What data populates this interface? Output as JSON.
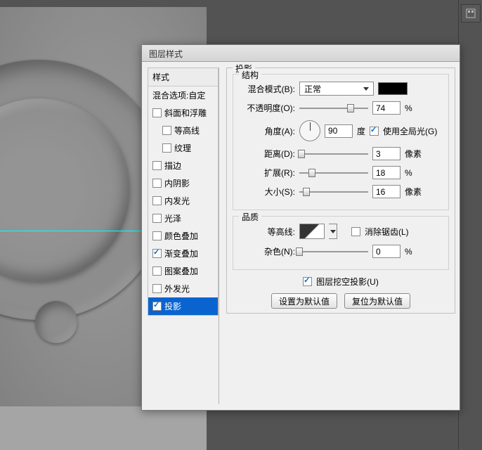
{
  "canvas": {
    "guide_visible": true
  },
  "dialog": {
    "title": "图层样式",
    "styles_panel": {
      "header": "样式",
      "blend_header": "混合选项:自定",
      "items": [
        {
          "label": "斜面和浮雕",
          "checked": false,
          "indent": false
        },
        {
          "label": "等高线",
          "checked": false,
          "indent": true
        },
        {
          "label": "纹理",
          "checked": false,
          "indent": true
        },
        {
          "label": "描边",
          "checked": false,
          "indent": false
        },
        {
          "label": "内阴影",
          "checked": false,
          "indent": false
        },
        {
          "label": "内发光",
          "checked": false,
          "indent": false
        },
        {
          "label": "光泽",
          "checked": false,
          "indent": false
        },
        {
          "label": "颜色叠加",
          "checked": false,
          "indent": false
        },
        {
          "label": "渐变叠加",
          "checked": true,
          "indent": false
        },
        {
          "label": "图案叠加",
          "checked": false,
          "indent": false
        },
        {
          "label": "外发光",
          "checked": false,
          "indent": false
        },
        {
          "label": "投影",
          "checked": true,
          "indent": false,
          "selected": true
        }
      ]
    },
    "drop_shadow": {
      "panel_title": "投影",
      "structure_title": "结构",
      "blend_mode_label": "混合模式(B):",
      "blend_mode_value": "正常",
      "color": "#000000",
      "opacity_label": "不透明度(O):",
      "opacity_value": "74",
      "opacity_unit": "%",
      "angle_label": "角度(A):",
      "angle_value": "90",
      "angle_unit": "度",
      "global_light_label": "使用全局光(G)",
      "global_light_checked": true,
      "distance_label": "距离(D):",
      "distance_value": "3",
      "distance_unit": "像素",
      "spread_label": "扩展(R):",
      "spread_value": "18",
      "spread_unit": "%",
      "size_label": "大小(S):",
      "size_value": "16",
      "size_unit": "像素",
      "quality_title": "品质",
      "contour_label": "等高线:",
      "antialias_label": "消除锯齿(L)",
      "antialias_checked": false,
      "noise_label": "杂色(N):",
      "noise_value": "0",
      "noise_unit": "%",
      "knockout_label": "图层挖空投影(U)",
      "knockout_checked": true,
      "make_default_btn": "设置为默认值",
      "reset_default_btn": "复位为默认值"
    }
  },
  "slider_positions": {
    "opacity": 74,
    "distance": 3,
    "spread": 18,
    "size": 10,
    "noise": 0
  }
}
